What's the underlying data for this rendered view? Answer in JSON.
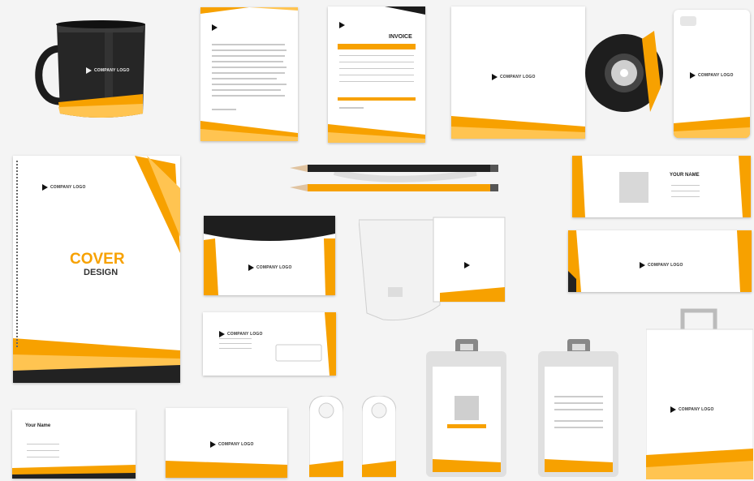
{
  "colors": {
    "accent": "#f7a100",
    "accent_light": "#ffc451",
    "dark": "#1b1b1b",
    "background": "#f4f4f4"
  },
  "logo": {
    "text": "COMPANY LOGO"
  },
  "invoice": {
    "title": "INVOICE"
  },
  "cover": {
    "title": "COVER",
    "subtitle": "DESIGN"
  },
  "business_card": {
    "name": "YOUR NAME",
    "name_small": "Your Name"
  }
}
